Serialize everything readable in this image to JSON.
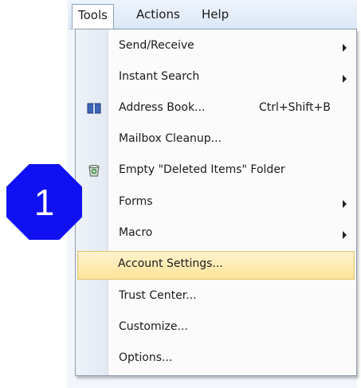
{
  "menubar": {
    "items": [
      {
        "label": "Tools"
      },
      {
        "label": "Actions"
      },
      {
        "label": "Help"
      }
    ]
  },
  "menu": {
    "items": [
      {
        "label": "Send/Receive",
        "submenu": true
      },
      {
        "label": "Instant Search",
        "submenu": true
      },
      {
        "label": "Address Book...",
        "shortcut": "Ctrl+Shift+B",
        "icon": "address-book-icon"
      },
      {
        "label": "Mailbox Cleanup..."
      },
      {
        "label": "Empty \"Deleted Items\" Folder",
        "icon": "recycle-bin-icon"
      },
      {
        "label": "Forms",
        "submenu": true
      },
      {
        "label": "Macro",
        "submenu": true
      },
      {
        "label": "Account Settings...",
        "highlighted": true
      },
      {
        "label": "Trust Center..."
      },
      {
        "label": "Customize..."
      },
      {
        "label": "Options..."
      }
    ]
  },
  "callout": {
    "number": "1",
    "color": "#1010f2"
  },
  "colors": {
    "highlight": "#fde49a",
    "menu_border": "#8e9aad"
  }
}
